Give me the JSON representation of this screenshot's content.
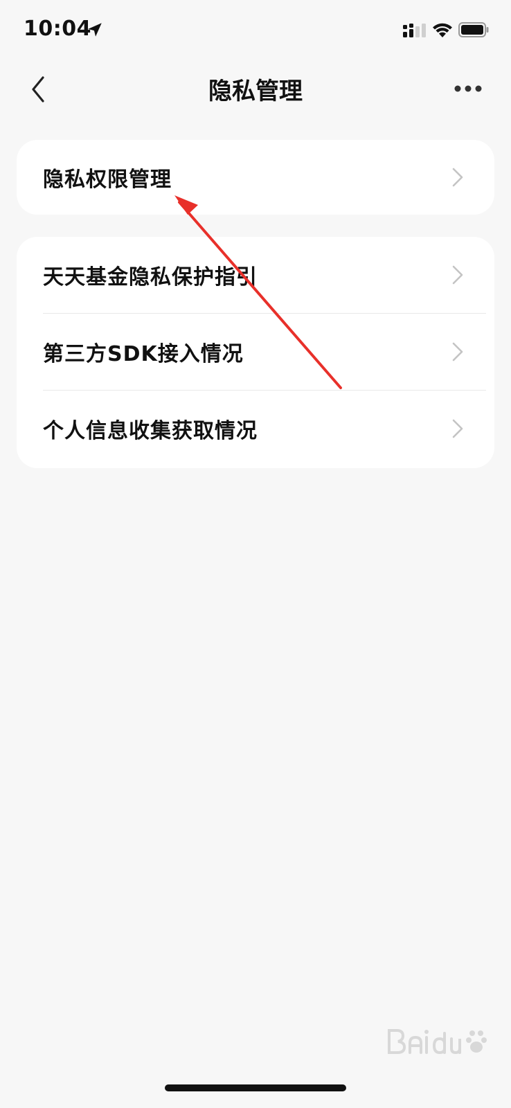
{
  "status_bar": {
    "time": "10:04",
    "icons": [
      "location-icon",
      "signal-icon",
      "wifi-icon",
      "battery-icon"
    ]
  },
  "nav": {
    "title": "隐私管理",
    "back_icon": "chevron-left-icon",
    "more_icon": "more-dots-icon"
  },
  "sections": [
    {
      "items": [
        {
          "label": "隐私权限管理"
        }
      ]
    },
    {
      "items": [
        {
          "label": "天天基金隐私保护指引"
        },
        {
          "label": "第三方SDK接入情况"
        },
        {
          "label": "个人信息收集获取情况"
        }
      ]
    }
  ],
  "annotation": {
    "color": "#e8302a"
  },
  "colors": {
    "background": "#f7f7f7",
    "card": "#ffffff",
    "text": "#111111",
    "chevron": "#c4c4c4",
    "divider": "#e8e8e8"
  }
}
